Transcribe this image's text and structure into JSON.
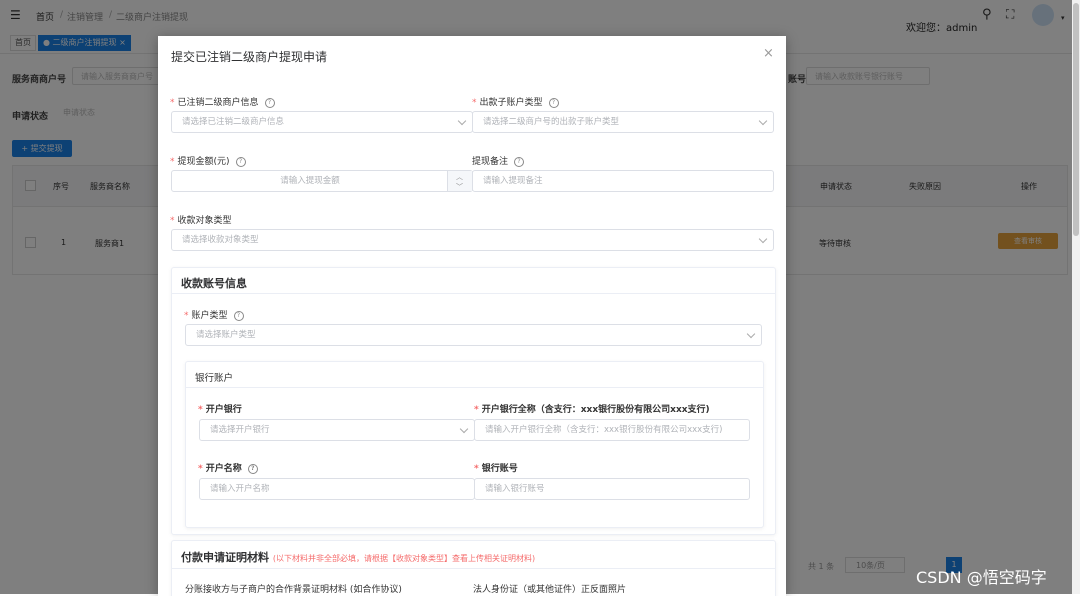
{
  "topbar": {
    "breadcrumb": [
      "首页",
      "注销管理",
      "二级商户注销提现"
    ],
    "welcome": "欢迎您：admin"
  },
  "tags": [
    "首页",
    "二级商户注销提现"
  ],
  "search": {
    "label1": "服务商商户号",
    "placeholder1": "请输入服务商商户号",
    "label2": "账号",
    "placeholder2": "请输入收款账号银行账号",
    "label3": "申请状态",
    "placeholder3": "申请状态"
  },
  "submit_button": "+ 提交提现",
  "table": {
    "headers": [
      "序号",
      "服务商名称",
      "申请状态",
      "失败原因",
      "操作"
    ],
    "row": {
      "index": "1",
      "name": "服务商1",
      "status": "等待审核",
      "action": "查看审核"
    }
  },
  "pagination": {
    "total": "共 1 条",
    "size": "10条/页",
    "page": "1"
  },
  "dialog": {
    "title": "提交已注销二级商户提现申请",
    "close": "×",
    "fields": {
      "merchant_label": "已注销二级商户信息",
      "merchant_placeholder": "请选择已注销二级商户信息",
      "sub_account_label": "出款子账户类型",
      "sub_account_placeholder": "请选择二级商户号的出款子账户类型",
      "amount_label": "提现金额(元)",
      "amount_placeholder": "请输入提现金额",
      "remark_label": "提现备注",
      "remark_placeholder": "请输入提现备注",
      "payee_type_label": "收款对象类型",
      "payee_type_placeholder": "请选择收款对象类型"
    },
    "account_card": {
      "title": "收款账号信息",
      "account_type_label": "账户类型",
      "account_type_placeholder": "请选择账户类型",
      "bank_card": {
        "title": "银行账户",
        "bank_label": "开户银行",
        "bank_placeholder": "请选择开户银行",
        "fullname_label": "开户银行全称（含支行：xxx银行股份有限公司xxx支行)",
        "fullname_placeholder": "请输入开户银行全称（含支行：xxx银行股份有限公司xxx支行)",
        "name_label": "开户名称",
        "name_placeholder": "请输入开户名称",
        "number_label": "银行账号",
        "number_placeholder": "请输入银行账号"
      }
    },
    "proof_card": {
      "title": "付款申请证明材料",
      "note": "(以下材料并非全部必填，请根据【收款对象类型】查看上传相关证明材料)",
      "item1": "分账接收方与子商户的合作背景证明材料 (如合作协议)",
      "item2": "法人身份证（或其他证件）正反面照片"
    }
  },
  "watermark": "CSDN @悟空码字"
}
